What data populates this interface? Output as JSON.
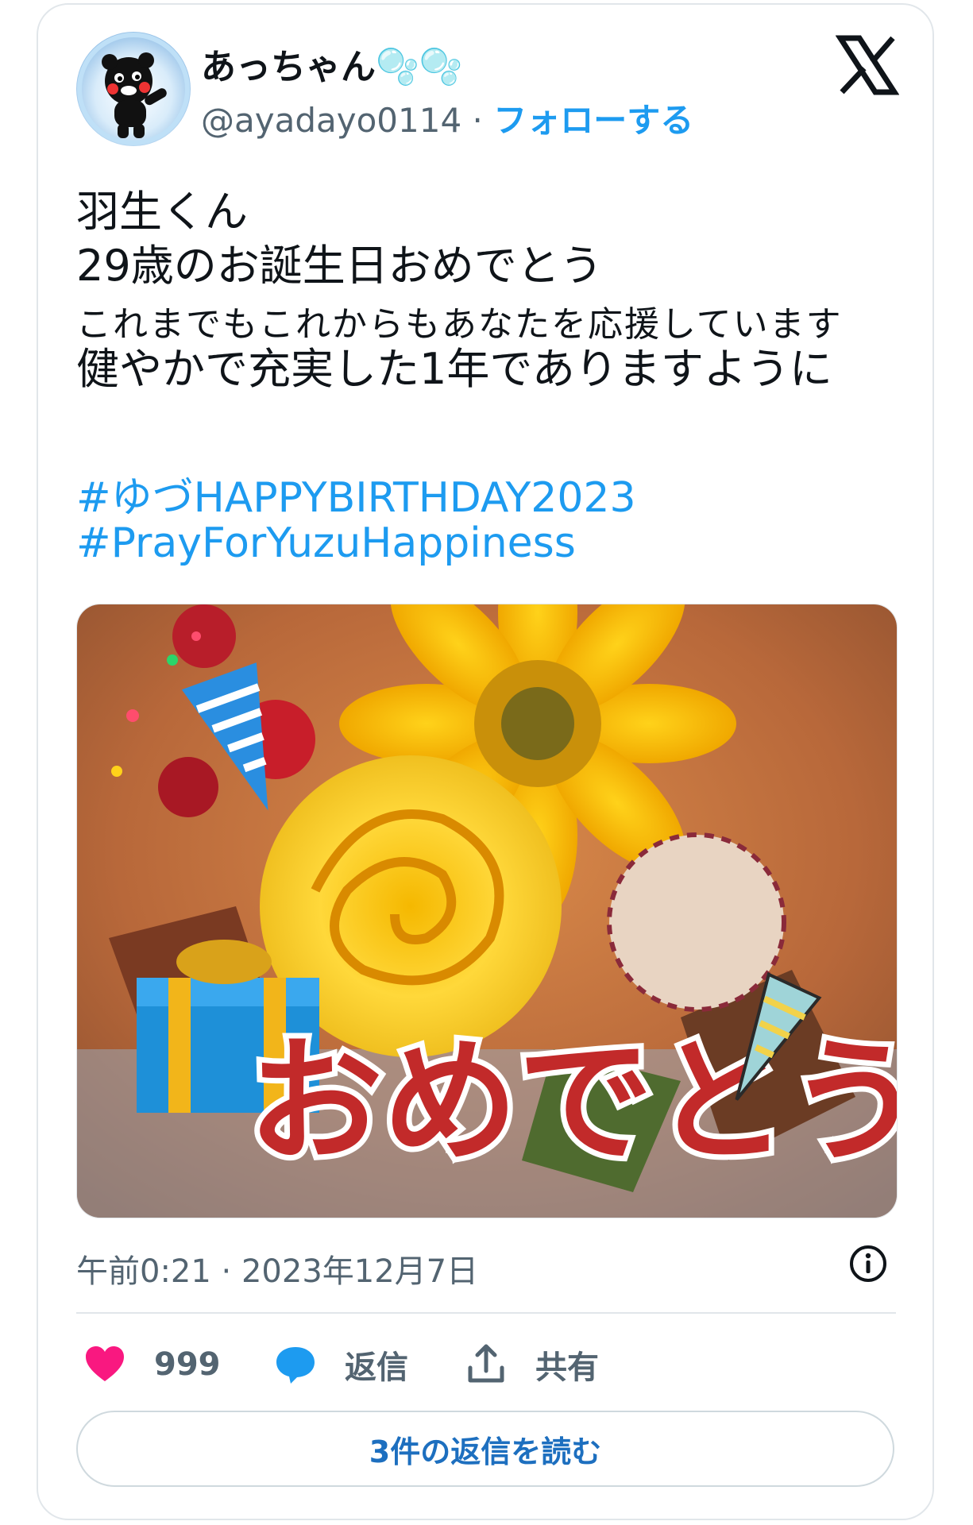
{
  "tweet": {
    "author_name": "あっちゃん🫧🫧",
    "author_handle": "@ayadayo0114",
    "separator": "·",
    "follow_label": "フォローする",
    "lines": [
      "羽生くん",
      "29歳のお誕生日おめでとう",
      "これまでもこれからもあなたを応援しています",
      "健やかで充実した1年でありますように"
    ],
    "hashtags": [
      "#ゆづHAPPYBIRTHDAY2023",
      "#PrayForYuzuHappiness"
    ],
    "image_caption": "おめでとう",
    "timestamp": "午前0:21 · 2023年12月7日",
    "likes": "999",
    "reply_label": "返信",
    "share_label": "共有",
    "read_replies_label": "3件の返信を読む"
  },
  "icons": [
    "x-logo-icon",
    "info-icon",
    "heart-icon",
    "reply-bubble-icon",
    "share-icon"
  ],
  "colors": {
    "link": "#1d9bf0",
    "heart": "#f91880",
    "text": "#0f1419",
    "muted": "#536471"
  }
}
